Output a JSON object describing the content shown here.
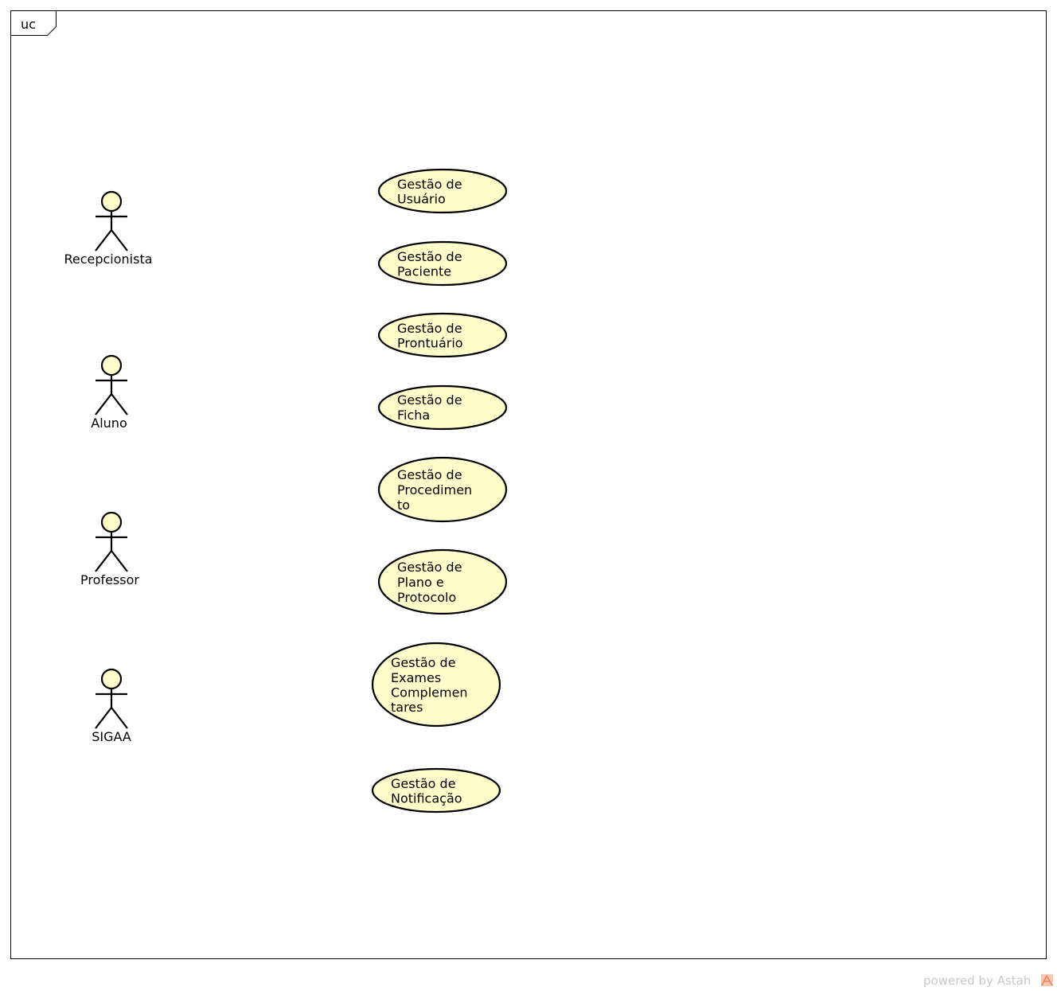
{
  "frame": {
    "tag": "uc"
  },
  "actors": [
    {
      "id": "recepcionista",
      "name": "Recepcionista"
    },
    {
      "id": "aluno",
      "name": "Aluno"
    },
    {
      "id": "professor",
      "name": "Professor"
    },
    {
      "id": "sigaa",
      "name": "SIGAA"
    }
  ],
  "use_cases": [
    {
      "id": "usuario",
      "lines": [
        "Gestão de",
        "Usuário"
      ]
    },
    {
      "id": "paciente",
      "lines": [
        "Gestão de",
        "Paciente"
      ]
    },
    {
      "id": "prontuario",
      "lines": [
        "Gestão de",
        "Prontuário"
      ]
    },
    {
      "id": "ficha",
      "lines": [
        "Gestão de",
        "Ficha"
      ]
    },
    {
      "id": "procedimento",
      "lines": [
        "Gestão de",
        "Procedimen",
        "to"
      ]
    },
    {
      "id": "plano",
      "lines": [
        "Gestão de",
        "Plano e",
        "Protocolo"
      ]
    },
    {
      "id": "exames",
      "lines": [
        "Gestão de",
        "Exames",
        "Complemen",
        "tares"
      ]
    },
    {
      "id": "notificacao",
      "lines": [
        "Gestão de",
        "Notificação"
      ]
    }
  ],
  "footer": {
    "text": "powered by Astah"
  },
  "colors": {
    "fill": "#ffffcc",
    "stroke": "#000000",
    "footer": "#c8c8c8",
    "logo": "#f0a080"
  }
}
